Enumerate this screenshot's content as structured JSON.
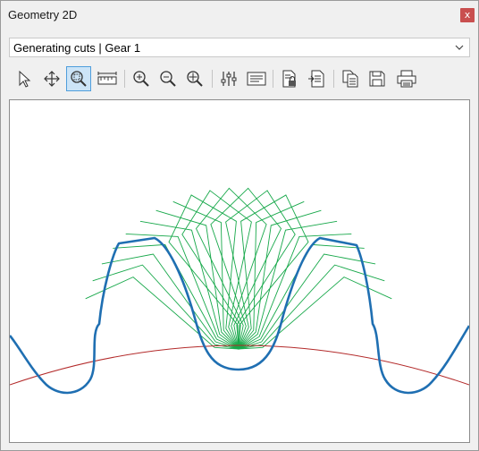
{
  "window": {
    "title": "Geometry 2D",
    "close_glyph": "x"
  },
  "view_selector": {
    "selected": "Generating cuts | Gear 1"
  },
  "toolbar": {
    "buttons": [
      {
        "name": "select-tool",
        "icon": "pointer-arrow-icon"
      },
      {
        "name": "pan-tool",
        "icon": "move-arrows-icon"
      },
      {
        "name": "zoom-window-tool",
        "icon": "zoom-window-icon",
        "active": true
      },
      {
        "name": "measure-tool",
        "icon": "ruler-icon"
      },
      {
        "name": "zoom-in-button",
        "icon": "zoom-in-icon"
      },
      {
        "name": "zoom-out-button",
        "icon": "zoom-out-icon"
      },
      {
        "name": "zoom-fit-button",
        "icon": "zoom-fit-icon"
      },
      {
        "name": "settings-button",
        "icon": "sliders-icon"
      },
      {
        "name": "legend-button",
        "icon": "text-lines-icon"
      },
      {
        "name": "lock-document-button",
        "icon": "document-lock-icon"
      },
      {
        "name": "document-edit-button",
        "icon": "document-edit-icon"
      },
      {
        "name": "copy-button",
        "icon": "copy-icon"
      },
      {
        "name": "save-button",
        "icon": "save-disk-icon"
      },
      {
        "name": "print-button",
        "icon": "printer-icon"
      }
    ]
  },
  "plot": {
    "colors": {
      "gear_profile": "#1f6fb2",
      "cutter_positions": "#17a84a",
      "pitch_circle": "#b32a2a"
    }
  }
}
